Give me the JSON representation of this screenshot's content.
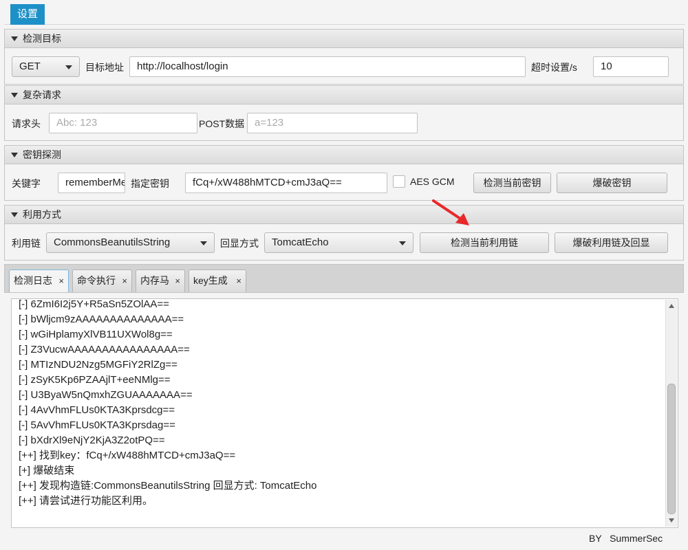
{
  "menu": {
    "settings": "设置"
  },
  "target_pane": {
    "title": "检测目标",
    "method": "GET",
    "url_label": "目标地址",
    "url_value": "http://localhost/login",
    "timeout_label": "超时设置/s",
    "timeout_value": "10"
  },
  "complex_pane": {
    "title": "复杂请求",
    "header_label": "请求头",
    "header_placeholder": "Abc: 123",
    "post_label": "POST数据",
    "post_placeholder": "a=123"
  },
  "key_pane": {
    "title": "密钥探测",
    "keyword_label": "关键字",
    "keyword_value": "rememberMe",
    "key_label": "指定密钥",
    "key_value": "fCq+/xW488hMTCD+cmJ3aQ==",
    "aes_gcm_label": "AES GCM",
    "check_key_button": "检测当前密钥",
    "brute_key_button": "爆破密钥"
  },
  "exploit_pane": {
    "title": "利用方式",
    "chain_label": "利用链",
    "chain_value": "CommonsBeanutilsString",
    "echo_label": "回显方式",
    "echo_value": "TomcatEcho",
    "check_chain_button": "检测当前利用链",
    "brute_chain_button": "爆破利用链及回显"
  },
  "tabs": [
    {
      "label": "检测日志",
      "close": "×"
    },
    {
      "label": "命令执行",
      "close": "×"
    },
    {
      "label": "内存马",
      "close": "×"
    },
    {
      "label": "key生成",
      "close": "×"
    }
  ],
  "log_lines": [
    "[-] 6ZmI6I2j5Y+R5aSn5ZOlAA==",
    "[-] bWljcm9zAAAAAAAAAAAAAA==",
    "[-] wGiHplamyXlVB11UXWol8g==",
    "[-] Z3VucwAAAAAAAAAAAAAAAA==",
    "[-] MTIzNDU2Nzg5MGFiY2RlZg==",
    "[-] zSyK5Kp6PZAAjlT+eeNMlg==",
    "[-] U3ByaW5nQmxhZGUAAAAAAA==",
    "[-] 4AvVhmFLUs0KTA3Kprsdcg==",
    "[-] 5AvVhmFLUs0KTA3Kprsdag==",
    "[-] bXdrXl9eNjY2KjA3Z2otPQ==",
    "[++] 找到key：fCq+/xW488hMTCD+cmJ3aQ==",
    "[+] 爆破结束",
    "[++] 发现构造链:CommonsBeanutilsString  回显方式: TomcatEcho",
    "[++] 请尝试进行功能区利用。"
  ],
  "footer": "BY   SummerSec",
  "colors": {
    "accent": "#1e90c8",
    "annotation_arrow": "#e8282a"
  }
}
